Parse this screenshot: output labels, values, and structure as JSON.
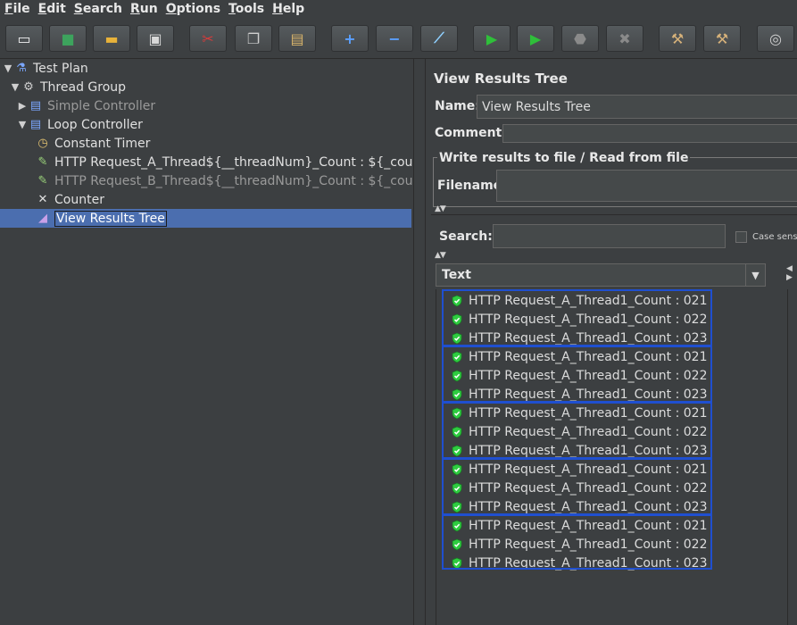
{
  "menu": [
    "File",
    "Edit",
    "Search",
    "Run",
    "Options",
    "Tools",
    "Help"
  ],
  "toolbar": {
    "buttons": [
      {
        "name": "new-button",
        "glyph": "▭",
        "color": "#f0f0f0"
      },
      {
        "name": "templates-button",
        "glyph": "■",
        "color": "#3da35d"
      },
      {
        "name": "open-button",
        "glyph": "▬",
        "color": "#e8b23a"
      },
      {
        "name": "save-button",
        "glyph": "▣",
        "color": "#d8d8d8"
      },
      {
        "name": "cut-button",
        "glyph": "✂",
        "color": "#d83b3b"
      },
      {
        "name": "copy-button",
        "glyph": "❐",
        "color": "#cfcfcf"
      },
      {
        "name": "paste-button",
        "glyph": "▤",
        "color": "#d9b46a"
      },
      {
        "name": "expand-button",
        "glyph": "+",
        "color": "#5aa0ff"
      },
      {
        "name": "collapse-button",
        "glyph": "−",
        "color": "#5aa0ff"
      },
      {
        "name": "toggle-button",
        "glyph": "⟋",
        "color": "#8fd0ff"
      },
      {
        "name": "start-button",
        "glyph": "▶",
        "color": "#2fbf3a"
      },
      {
        "name": "start-no-pauses-button",
        "glyph": "▶",
        "color": "#2fbf3a"
      },
      {
        "name": "stop-button",
        "glyph": "⬣",
        "color": "#8a8a8a"
      },
      {
        "name": "shutdown-button",
        "glyph": "✖",
        "color": "#8a8a8a"
      },
      {
        "name": "clear-button",
        "glyph": "⚒",
        "color": "#d7b27a"
      },
      {
        "name": "clear-all-button",
        "glyph": "⚒",
        "color": "#d7b27a"
      },
      {
        "name": "search-button",
        "glyph": "◎",
        "color": "#d0d0d0"
      }
    ]
  },
  "tree": [
    {
      "label": "Test Plan",
      "icon": "flask-icon",
      "glyph": "⚗",
      "color": "#7aa7ff",
      "arrow": "▼",
      "disabled": false
    },
    {
      "label": "Thread Group",
      "icon": "gear-icon",
      "glyph": "⚙",
      "color": "#d0d0d0",
      "arrow": "▼",
      "disabled": false
    },
    {
      "label": "Simple Controller",
      "icon": "controller-icon",
      "glyph": "▤",
      "color": "#7aa7ff",
      "arrow": "▶",
      "disabled": true
    },
    {
      "label": "Loop Controller",
      "icon": "controller-icon",
      "glyph": "▤",
      "color": "#7aa7ff",
      "arrow": "▼",
      "disabled": false
    },
    {
      "label": "Constant Timer",
      "icon": "timer-icon",
      "glyph": "◷",
      "color": "#e0c070",
      "arrow": "",
      "disabled": false
    },
    {
      "label": "HTTP Request_A_Thread${__threadNum}_Count : ${_count}",
      "icon": "pipette-icon",
      "glyph": "✎",
      "color": "#9ad27a",
      "arrow": "",
      "disabled": false
    },
    {
      "label": "HTTP Request_B_Thread${__threadNum}_Count : ${_count}",
      "icon": "pipette-icon",
      "glyph": "✎",
      "color": "#9ad27a",
      "arrow": "",
      "disabled": true
    },
    {
      "label": "Counter",
      "icon": "tools-icon",
      "glyph": "✕",
      "color": "#e0e0e0",
      "arrow": "",
      "disabled": false
    },
    {
      "label": "View Results Tree",
      "icon": "chart-icon",
      "glyph": "◢",
      "color": "#c8a0e8",
      "arrow": "",
      "disabled": false,
      "selected": true
    }
  ],
  "panel": {
    "title": "View Results Tree",
    "name_label": "Name:",
    "name_value": "View Results Tree",
    "comments_label": "Comments:",
    "group_title": "Write results to file / Read from file",
    "filename_label": "Filename",
    "search_label": "Search:",
    "search_value": "",
    "case_label": "Case sensit",
    "renderer": "Text"
  },
  "results": [
    "HTTP Request_A_Thread1_Count : 021",
    "HTTP Request_A_Thread1_Count : 022",
    "HTTP Request_A_Thread1_Count : 023",
    "HTTP Request_A_Thread1_Count : 021",
    "HTTP Request_A_Thread1_Count : 022",
    "HTTP Request_A_Thread1_Count : 023",
    "HTTP Request_A_Thread1_Count : 021",
    "HTTP Request_A_Thread1_Count : 022",
    "HTTP Request_A_Thread1_Count : 023",
    "HTTP Request_A_Thread1_Count : 021",
    "HTTP Request_A_Thread1_Count : 022",
    "HTTP Request_A_Thread1_Count : 023",
    "HTTP Request_A_Thread1_Count : 021",
    "HTTP Request_A_Thread1_Count : 022",
    "HTTP Request_A_Thread1_Count : 023"
  ],
  "colors": {
    "highlight": "#1f4fd0",
    "success": "#2ecc40",
    "selection": "#4b6eaf"
  }
}
